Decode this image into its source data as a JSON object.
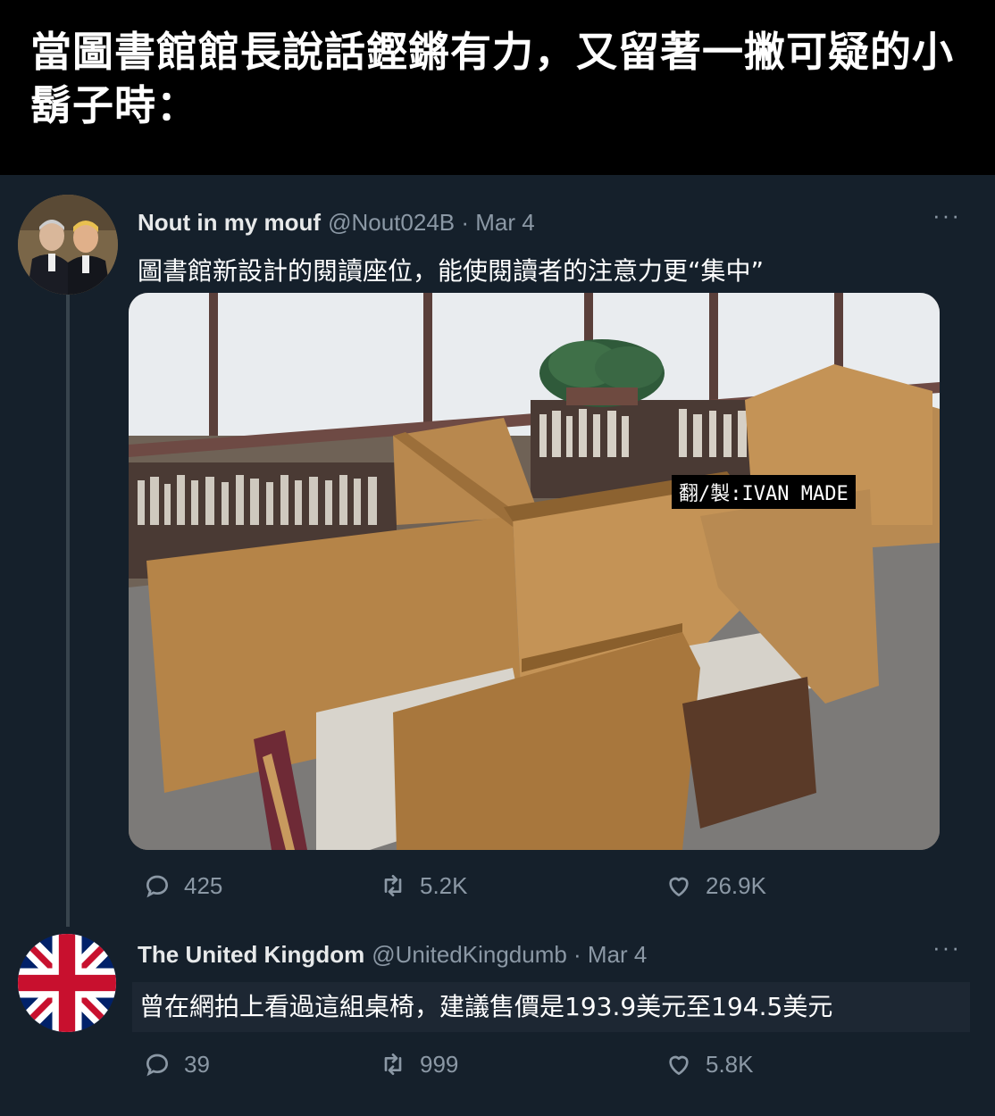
{
  "caption": "當圖書館館長說話鏗鏘有力，又留著一撇可疑的小鬍子時：",
  "tweet1": {
    "display_name": "Nout in my mouf",
    "handle_date": "@Nout024B · Mar 4",
    "more": "···",
    "text": "圖書館新設計的閱讀座位，能使閱讀者的注意力更“集中”",
    "watermark": "翻/製:IVAN MADE",
    "replies": "425",
    "retweets": "5.2K",
    "likes": "26.9K"
  },
  "tweet2": {
    "display_name": "The United Kingdom",
    "handle_date": "@UnitedKingdumb · Mar 4",
    "more": "···",
    "text": "曾在網拍上看過這組桌椅，建議售價是193.9美元至194.5美元",
    "replies": "39",
    "retweets": "999",
    "likes": "5.8K"
  },
  "icons": {
    "reply": "reply-icon",
    "retweet": "retweet-icon",
    "like": "heart-icon",
    "more": "more-icon"
  },
  "colors": {
    "background": "#15202b",
    "caption_background": "#000000",
    "secondary_text": "#8b98a5",
    "flag_red": "#c8102e",
    "flag_blue": "#012169"
  }
}
